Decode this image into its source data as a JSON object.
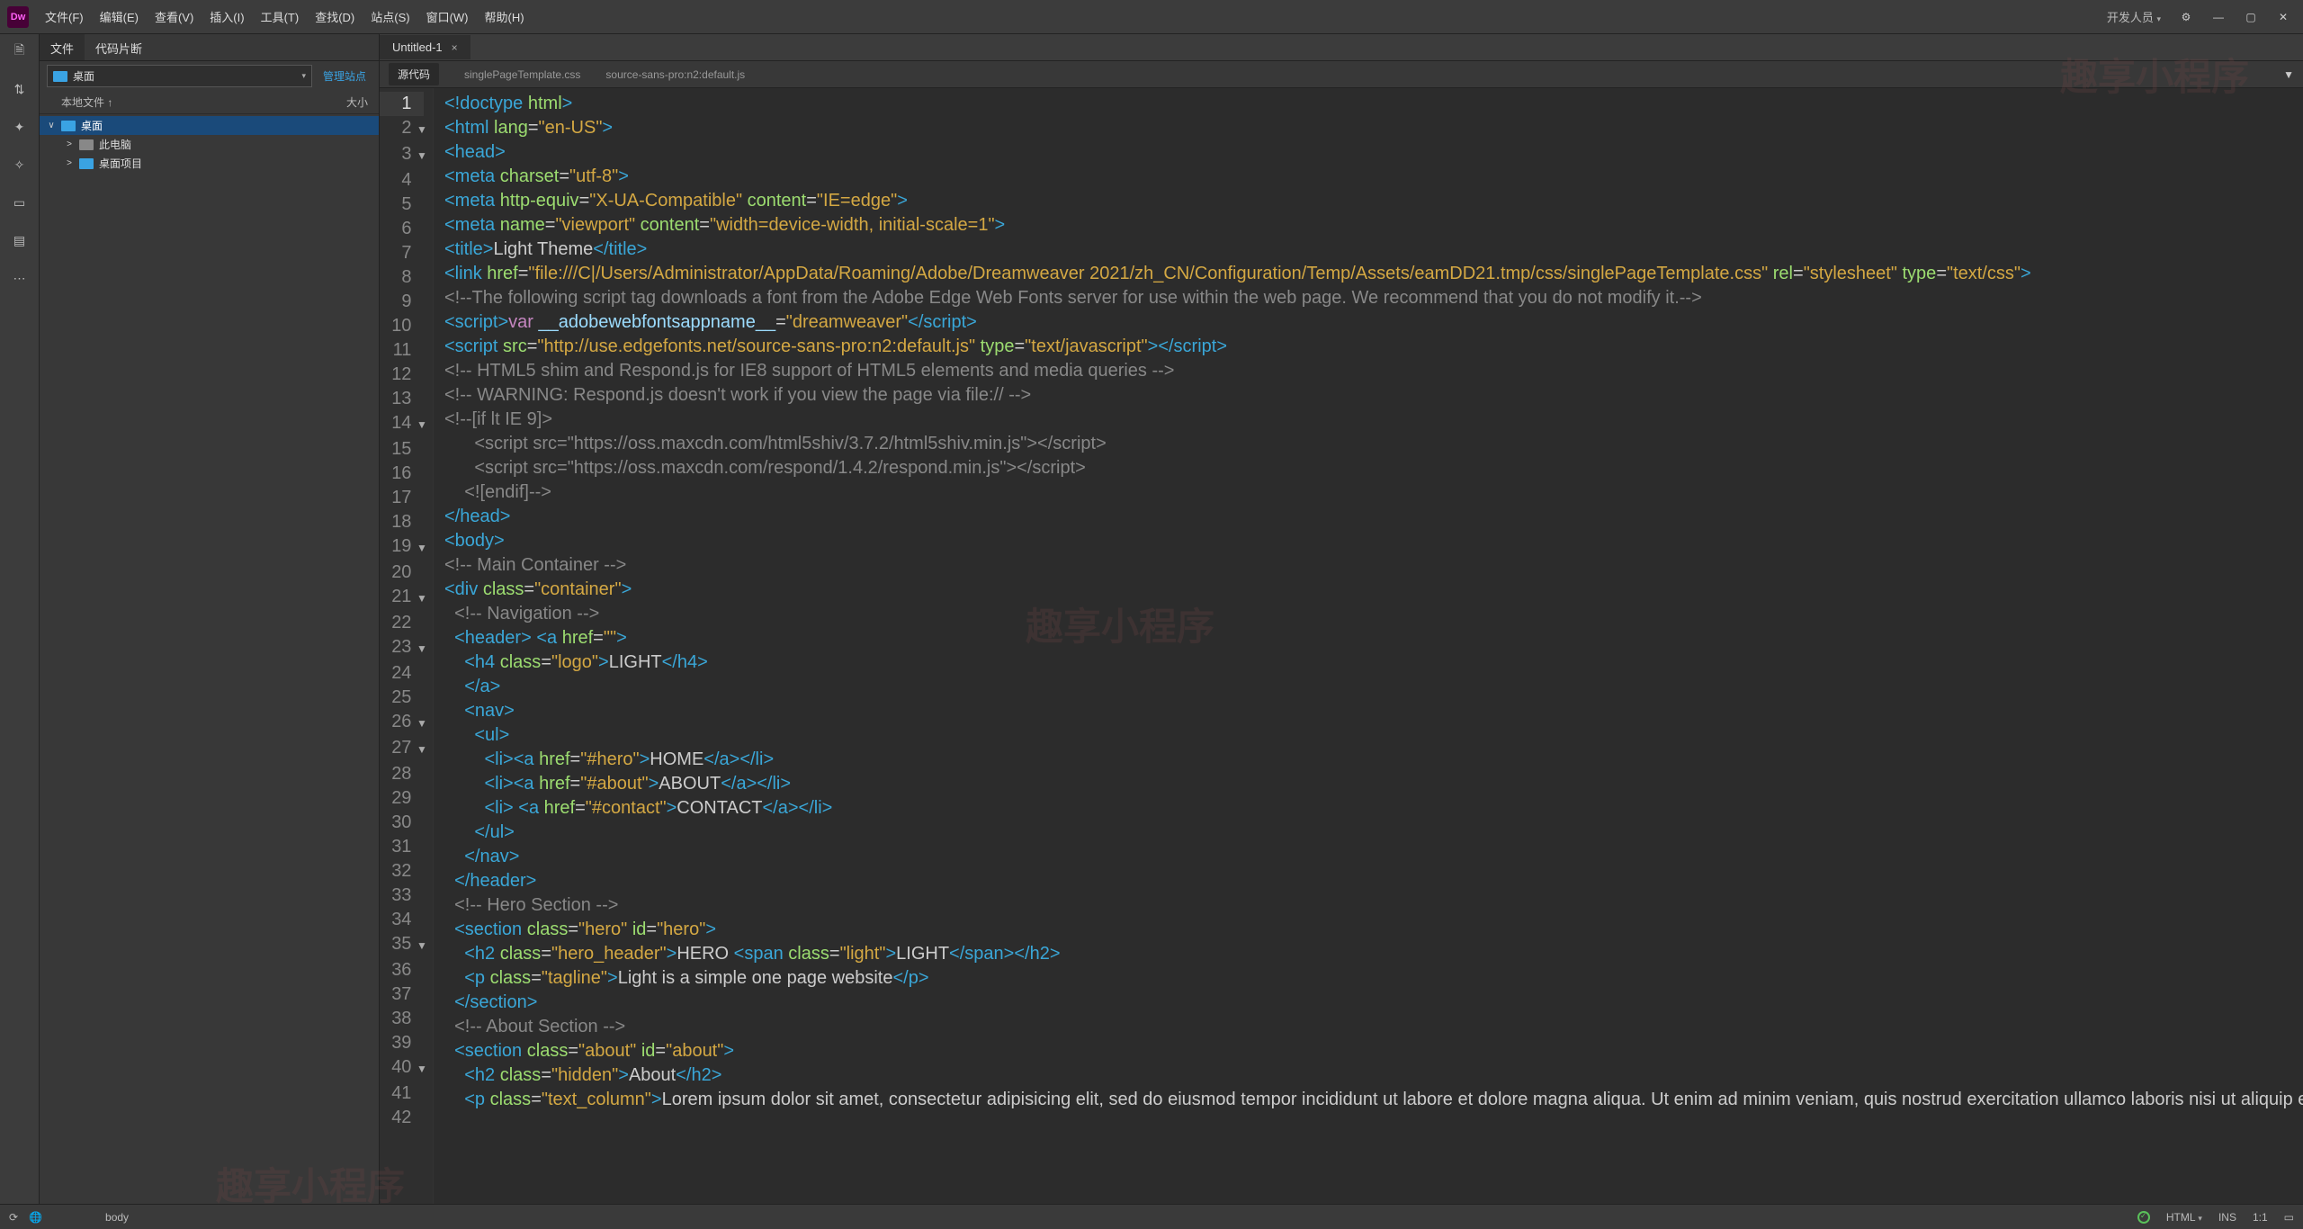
{
  "logo": "Dw",
  "menu": [
    "文件(F)",
    "编辑(E)",
    "查看(V)",
    "插入(I)",
    "工具(T)",
    "查找(D)",
    "站点(S)",
    "窗口(W)",
    "帮助(H)"
  ],
  "workspace": "开发人员",
  "panel": {
    "tabs": [
      "文件",
      "代码片断"
    ],
    "drive_label": "桌面",
    "manage": "管理站点",
    "col_file": "本地文件 ↑",
    "col_size": "大小",
    "tree": [
      {
        "lvl": 0,
        "icon": "folder",
        "label": "桌面",
        "tw": "∨",
        "sel": true
      },
      {
        "lvl": 1,
        "icon": "pc",
        "label": "此电脑",
        "tw": ">"
      },
      {
        "lvl": 1,
        "icon": "folder",
        "label": "桌面项目",
        "tw": ">"
      }
    ]
  },
  "doc": {
    "title": "Untitled-1",
    "subtabs": [
      "源代码",
      "singlePageTemplate.css",
      "source-sans-pro:n2:default.js"
    ]
  },
  "status": {
    "breadcrumb": "body",
    "lang": "HTML",
    "ins": "INS",
    "pos": "1:1"
  },
  "watermark": "趣享小程序",
  "code_lines": [
    {
      "n": 1,
      "fold": "",
      "html": "<span class='t-tag'>&lt;!doctype</span> <span class='t-attr'>html</span><span class='t-tag'>&gt;</span>"
    },
    {
      "n": 2,
      "fold": "▼",
      "html": "<span class='t-tag'>&lt;html</span> <span class='t-attr'>lang</span>=<span class='t-str'>\"en-US\"</span><span class='t-tag'>&gt;</span>"
    },
    {
      "n": 3,
      "fold": "▼",
      "html": "<span class='t-tag'>&lt;head&gt;</span>"
    },
    {
      "n": 4,
      "fold": "",
      "html": "<span class='t-tag'>&lt;meta</span> <span class='t-attr'>charset</span>=<span class='t-str'>\"utf-8\"</span><span class='t-tag'>&gt;</span>"
    },
    {
      "n": 5,
      "fold": "",
      "html": "<span class='t-tag'>&lt;meta</span> <span class='t-attr'>http-equiv</span>=<span class='t-str'>\"X-UA-Compatible\"</span> <span class='t-attr'>content</span>=<span class='t-str'>\"IE=edge\"</span><span class='t-tag'>&gt;</span>"
    },
    {
      "n": 6,
      "fold": "",
      "html": "<span class='t-tag'>&lt;meta</span> <span class='t-attr'>name</span>=<span class='t-str'>\"viewport\"</span> <span class='t-attr'>content</span>=<span class='t-str'>\"width=device-width, initial-scale=1\"</span><span class='t-tag'>&gt;</span>"
    },
    {
      "n": 7,
      "fold": "",
      "html": "<span class='t-tag'>&lt;title&gt;</span>Light Theme<span class='t-tag'>&lt;/title&gt;</span>"
    },
    {
      "n": 8,
      "fold": "",
      "html": "<span class='t-tag'>&lt;link</span> <span class='t-attr'>href</span>=<span class='t-str'>\"file:///C|/Users/Administrator/AppData/Roaming/Adobe/Dreamweaver 2021/zh_CN/Configuration/Temp/Assets/eamDD21.tmp/css/singlePageTemplate.css\"</span> <span class='t-attr'>rel</span>=<span class='t-str'>\"stylesheet\"</span> <span class='t-attr'>type</span>=<span class='t-str'>\"text/css\"</span><span class='t-tag'>&gt;</span>"
    },
    {
      "n": 9,
      "fold": "",
      "html": "<span class='t-com'>&lt;!--The following script tag downloads a font from the Adobe Edge Web Fonts server for use within the web page. We recommend that you do not modify it.--&gt;</span>"
    },
    {
      "n": 10,
      "fold": "",
      "html": "<span class='t-tag'>&lt;script&gt;</span><span class='t-kw'>var</span> <span class='t-var'>__adobewebfontsappname__</span>=<span class='t-str'>\"dreamweaver\"</span><span class='t-tag'>&lt;/script&gt;</span>"
    },
    {
      "n": 11,
      "fold": "",
      "html": "<span class='t-tag'>&lt;script</span> <span class='t-attr'>src</span>=<span class='t-str'>\"http://use.edgefonts.net/source-sans-pro:n2:default.js\"</span> <span class='t-attr'>type</span>=<span class='t-str'>\"text/javascript\"</span><span class='t-tag'>&gt;&lt;/script&gt;</span>"
    },
    {
      "n": 12,
      "fold": "",
      "html": "<span class='t-com'>&lt;!-- HTML5 shim and Respond.js for IE8 support of HTML5 elements and media queries --&gt;</span>"
    },
    {
      "n": 13,
      "fold": "",
      "html": "<span class='t-com'>&lt;!-- WARNING: Respond.js doesn't work if you view the page via file:// --&gt;</span>"
    },
    {
      "n": 14,
      "fold": "▼",
      "html": "<span class='t-com'>&lt;!--[if lt IE 9]&gt;</span>"
    },
    {
      "n": 15,
      "fold": "",
      "html": "<span class='t-com'>      &lt;script src=\"https://oss.maxcdn.com/html5shiv/3.7.2/html5shiv.min.js\"&gt;&lt;/script&gt;</span>"
    },
    {
      "n": 16,
      "fold": "",
      "html": "<span class='t-com'>      &lt;script src=\"https://oss.maxcdn.com/respond/1.4.2/respond.min.js\"&gt;&lt;/script&gt;</span>"
    },
    {
      "n": 17,
      "fold": "",
      "html": "<span class='t-com'>    &lt;![endif]--&gt;</span>"
    },
    {
      "n": 18,
      "fold": "",
      "html": "<span class='t-tag'>&lt;/head&gt;</span>"
    },
    {
      "n": 19,
      "fold": "▼",
      "html": "<span class='t-tag'>&lt;body&gt;</span>"
    },
    {
      "n": 20,
      "fold": "",
      "html": "<span class='t-com'>&lt;!-- Main Container --&gt;</span>"
    },
    {
      "n": 21,
      "fold": "▼",
      "html": "<span class='t-tag'>&lt;div</span> <span class='t-attr'>class</span>=<span class='t-str'>\"container\"</span><span class='t-tag'>&gt;</span>"
    },
    {
      "n": 22,
      "fold": "",
      "html": "  <span class='t-com'>&lt;!-- Navigation --&gt;</span>"
    },
    {
      "n": 23,
      "fold": "▼",
      "html": "  <span class='t-tag'>&lt;header&gt;</span> <span class='t-tag'>&lt;a</span> <span class='t-attr'>href</span>=<span class='t-str'>\"\"</span><span class='t-tag'>&gt;</span>"
    },
    {
      "n": 24,
      "fold": "",
      "html": "    <span class='t-tag'>&lt;h4</span> <span class='t-attr'>class</span>=<span class='t-str'>\"logo\"</span><span class='t-tag'>&gt;</span>LIGHT<span class='t-tag'>&lt;/h4&gt;</span>"
    },
    {
      "n": 25,
      "fold": "",
      "html": "    <span class='t-tag'>&lt;/a&gt;</span>"
    },
    {
      "n": 26,
      "fold": "▼",
      "html": "    <span class='t-tag'>&lt;nav&gt;</span>"
    },
    {
      "n": 27,
      "fold": "▼",
      "html": "      <span class='t-tag'>&lt;ul&gt;</span>"
    },
    {
      "n": 28,
      "fold": "",
      "html": "        <span class='t-tag'>&lt;li&gt;&lt;a</span> <span class='t-attr'>href</span>=<span class='t-str'>\"#hero\"</span><span class='t-tag'>&gt;</span>HOME<span class='t-tag'>&lt;/a&gt;&lt;/li&gt;</span>"
    },
    {
      "n": 29,
      "fold": "",
      "html": "        <span class='t-tag'>&lt;li&gt;&lt;a</span> <span class='t-attr'>href</span>=<span class='t-str'>\"#about\"</span><span class='t-tag'>&gt;</span>ABOUT<span class='t-tag'>&lt;/a&gt;&lt;/li&gt;</span>"
    },
    {
      "n": 30,
      "fold": "",
      "html": "        <span class='t-tag'>&lt;li&gt;</span> <span class='t-tag'>&lt;a</span> <span class='t-attr'>href</span>=<span class='t-str'>\"#contact\"</span><span class='t-tag'>&gt;</span>CONTACT<span class='t-tag'>&lt;/a&gt;&lt;/li&gt;</span>"
    },
    {
      "n": 31,
      "fold": "",
      "html": "      <span class='t-tag'>&lt;/ul&gt;</span>"
    },
    {
      "n": 32,
      "fold": "",
      "html": "    <span class='t-tag'>&lt;/nav&gt;</span>"
    },
    {
      "n": 33,
      "fold": "",
      "html": "  <span class='t-tag'>&lt;/header&gt;</span>"
    },
    {
      "n": 34,
      "fold": "",
      "html": "  <span class='t-com'>&lt;!-- Hero Section --&gt;</span>"
    },
    {
      "n": 35,
      "fold": "▼",
      "html": "  <span class='t-tag'>&lt;section</span> <span class='t-attr'>class</span>=<span class='t-str'>\"hero\"</span> <span class='t-attr'>id</span>=<span class='t-str'>\"hero\"</span><span class='t-tag'>&gt;</span>"
    },
    {
      "n": 36,
      "fold": "",
      "html": "    <span class='t-tag'>&lt;h2</span> <span class='t-attr'>class</span>=<span class='t-str'>\"hero_header\"</span><span class='t-tag'>&gt;</span>HERO <span class='t-tag'>&lt;span</span> <span class='t-attr'>class</span>=<span class='t-str'>\"light\"</span><span class='t-tag'>&gt;</span>LIGHT<span class='t-tag'>&lt;/span&gt;&lt;/h2&gt;</span>"
    },
    {
      "n": 37,
      "fold": "",
      "html": "    <span class='t-tag'>&lt;p</span> <span class='t-attr'>class</span>=<span class='t-str'>\"tagline\"</span><span class='t-tag'>&gt;</span>Light is a simple one page website<span class='t-tag'>&lt;/p&gt;</span>"
    },
    {
      "n": 38,
      "fold": "",
      "html": "  <span class='t-tag'>&lt;/section&gt;</span>"
    },
    {
      "n": 39,
      "fold": "",
      "html": "  <span class='t-com'>&lt;!-- About Section --&gt;</span>"
    },
    {
      "n": 40,
      "fold": "▼",
      "html": "  <span class='t-tag'>&lt;section</span> <span class='t-attr'>class</span>=<span class='t-str'>\"about\"</span> <span class='t-attr'>id</span>=<span class='t-str'>\"about\"</span><span class='t-tag'>&gt;</span>"
    },
    {
      "n": 41,
      "fold": "",
      "html": "    <span class='t-tag'>&lt;h2</span> <span class='t-attr'>class</span>=<span class='t-str'>\"hidden\"</span><span class='t-tag'>&gt;</span>About<span class='t-tag'>&lt;/h2&gt;</span>"
    },
    {
      "n": 42,
      "fold": "",
      "html": "    <span class='t-tag'>&lt;p</span> <span class='t-attr'>class</span>=<span class='t-str'>\"text_column\"</span><span class='t-tag'>&gt;</span>Lorem ipsum dolor sit amet, consectetur adipisicing elit, sed do eiusmod tempor incididunt ut labore et dolore magna aliqua. Ut enim ad minim veniam, quis nostrud exercitation ullamco laboris nisi ut aliquip ex ea commodo consequat. Duis aute irure dolor in reprehenderit in voluptate velit esse cillum dolore eu fugiat nulla pariatur. <span class='t-tag'>&lt;/p&gt;</span>"
    }
  ]
}
